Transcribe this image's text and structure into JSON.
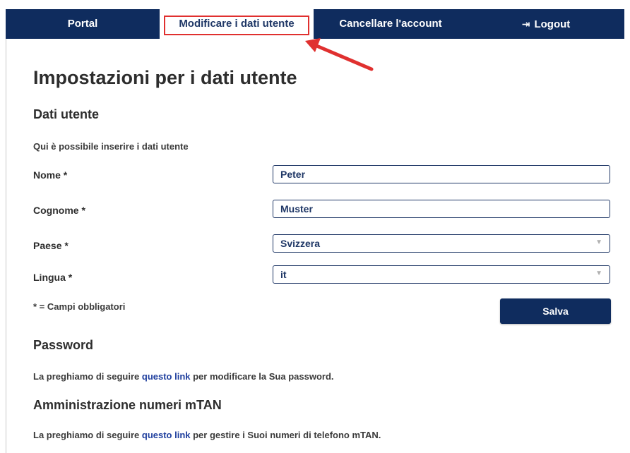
{
  "nav": {
    "items": [
      {
        "label": "Portal"
      },
      {
        "label": "Modificare i dati utente"
      },
      {
        "label": "Cancellare l'account"
      },
      {
        "label": "Logout"
      }
    ],
    "active_index": 1,
    "logout_icon": "logout-icon",
    "highlight_color": "#e0302f"
  },
  "page": {
    "title": "Impostazioni per i dati utente",
    "section_user": "Dati utente",
    "intro": "Qui è possibile inserire i dati utente",
    "required_note": "* = Campi obbligatori",
    "save_label": "Salva"
  },
  "form": {
    "nome": {
      "label": "Nome *",
      "value": "Peter"
    },
    "cognome": {
      "label": "Cognome *",
      "value": "Muster"
    },
    "paese": {
      "label": "Paese *",
      "value": "Svizzera"
    },
    "lingua": {
      "label": "Lingua *",
      "value": "it"
    }
  },
  "password": {
    "title": "Password",
    "text_before": "La preghiamo di seguire ",
    "link": "questo link",
    "text_after": " per modificare la Sua password."
  },
  "mtan": {
    "title": "Amministrazione numeri mTAN",
    "text_before": "La preghiamo di seguire ",
    "link": "questo link",
    "text_after": " per gestire i Suoi numeri di telefono mTAN."
  },
  "colors": {
    "nav_bg": "#0f2c5e",
    "link": "#1f3f9e",
    "annotation": "#e0302f"
  }
}
